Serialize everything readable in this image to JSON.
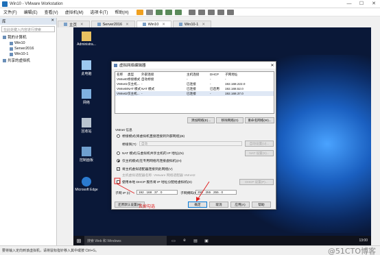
{
  "window": {
    "title": "Win10 - VMware Workstation",
    "minimize": "—",
    "maximize": "☐",
    "close": "✕"
  },
  "menubar": {
    "items": [
      "文件(F)",
      "编辑(E)",
      "查看(V)",
      "虚拟机(M)",
      "选项卡(T)",
      "帮助(H)"
    ]
  },
  "tabs": [
    {
      "label": "主页",
      "close": "✕"
    },
    {
      "label": "Server2016",
      "close": "✕"
    },
    {
      "label": "Win10",
      "close": "✕",
      "active": true
    },
    {
      "label": "Win10-1",
      "close": "✕"
    }
  ],
  "library": {
    "header": "库",
    "close": "✕",
    "search_placeholder": "在此处键入内容进行搜索",
    "items": [
      {
        "label": "我的计算机",
        "level": 1
      },
      {
        "label": "Win10",
        "level": 2
      },
      {
        "label": "Server2016",
        "level": 2
      },
      {
        "label": "Win10-1",
        "level": 2
      },
      {
        "label": "共享的虚拟机",
        "level": 1
      }
    ]
  },
  "desktop_icons": [
    "Administra...",
    "此电脑",
    "网络",
    "回收站",
    "控制面板",
    "Microsoft Edge"
  ],
  "taskbar": {
    "search": "搜索 Web 和 Windows",
    "time": "13:00",
    "date": "2018/..."
  },
  "dialog": {
    "title": "虚拟网络编辑器",
    "close": "✕",
    "columns": [
      "名称",
      "类型",
      "外部连接",
      "主机连接",
      "DHCP",
      "子网地址"
    ],
    "rows": [
      {
        "name": "VMnet0",
        "type": "桥接模式",
        "ext": "自动桥接",
        "host": "-",
        "dhcp": "-",
        "subnet": "-"
      },
      {
        "name": "VMnet1",
        "type": "仅主机...",
        "ext": "-",
        "host": "已连接",
        "dhcp": "-",
        "subnet": "192.168.222.0"
      },
      {
        "name": "VMnet8",
        "type": "NAT 模式",
        "ext": "NAT 模式",
        "host": "已连接",
        "dhcp": "已启用",
        "subnet": "192.168.52.0"
      },
      {
        "name": "VMnet2",
        "type": "仅主机...",
        "ext": "-",
        "host": "已连接",
        "dhcp": "-",
        "subnet": "192.168.37.0"
      }
    ],
    "add_network": "添加网络(E)...",
    "remove_network": "移除网络(O)",
    "rename_network": "重命名网络(W)...",
    "vmnet_info": "VMnet 信息",
    "bridged_option": "桥接模式(将虚拟机直接连接到外部网络)(B)",
    "bridged_to_label": "桥接到(T):",
    "bridged_to_value": "自动",
    "auto_settings": "自动设置(U)...",
    "nat_option": "NAT 模式(与虚拟机共享主机的 IP 地址)(N)",
    "nat_settings": "NAT 设置(S)...",
    "hostonly_option": "仅主机模式(在专用网络内连接虚拟机)(H)",
    "connect_adapter": "将主机虚拟适配器连接到此网络(V)",
    "adapter_name": "主机虚拟适配器名称: VMware 网络适配器 VMnet2",
    "dhcp_service": "使用本地 DHCP 服务将 IP 地址分配给虚拟机(D)",
    "dhcp_settings": "DHCP 设置(P)...",
    "subnet_ip_label": "子网 IP (I):",
    "subnet_ip": "192 . 168 . 37 . 0",
    "subnet_mask_label": "子网掩码(M):",
    "subnet_mask": "255 . 255 . 255 . 0",
    "restore_defaults": "还原默认设置(R)",
    "ok": "确定",
    "cancel": "取消",
    "apply": "应用(A)",
    "help": "帮助"
  },
  "annotation": "去掉勾选",
  "status": {
    "text": "要将输入定向到该虚拟机，请将鼠标指针移入其中或按 Ctrl+G。",
    "watermark": "@51CTO博客"
  },
  "colors": {
    "desktop": "#0a1838",
    "accent": "#0078d7",
    "annotation": "#e02020"
  }
}
